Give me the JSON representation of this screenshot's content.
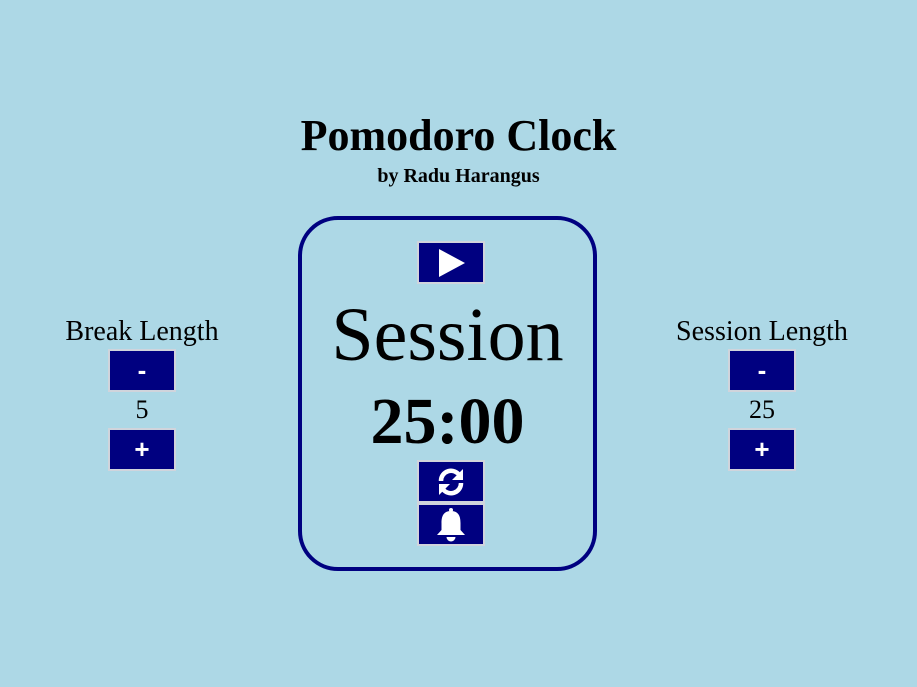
{
  "header": {
    "title": "Pomodoro Clock",
    "subtitle": "by Radu Harangus"
  },
  "break_control": {
    "label": "Break Length",
    "decrement_label": "-",
    "value": "5",
    "increment_label": "+"
  },
  "session_control": {
    "label": "Session Length",
    "decrement_label": "-",
    "value": "25",
    "increment_label": "+"
  },
  "clock": {
    "mode_label": "Session",
    "time_display": "25:00",
    "icons": {
      "play": "play-icon",
      "reset": "refresh-icon",
      "alarm": "bell-icon"
    }
  },
  "colors": {
    "background": "#add8e6",
    "button": "#000080",
    "clock_border": "#000080",
    "icon": "#ffffff"
  }
}
